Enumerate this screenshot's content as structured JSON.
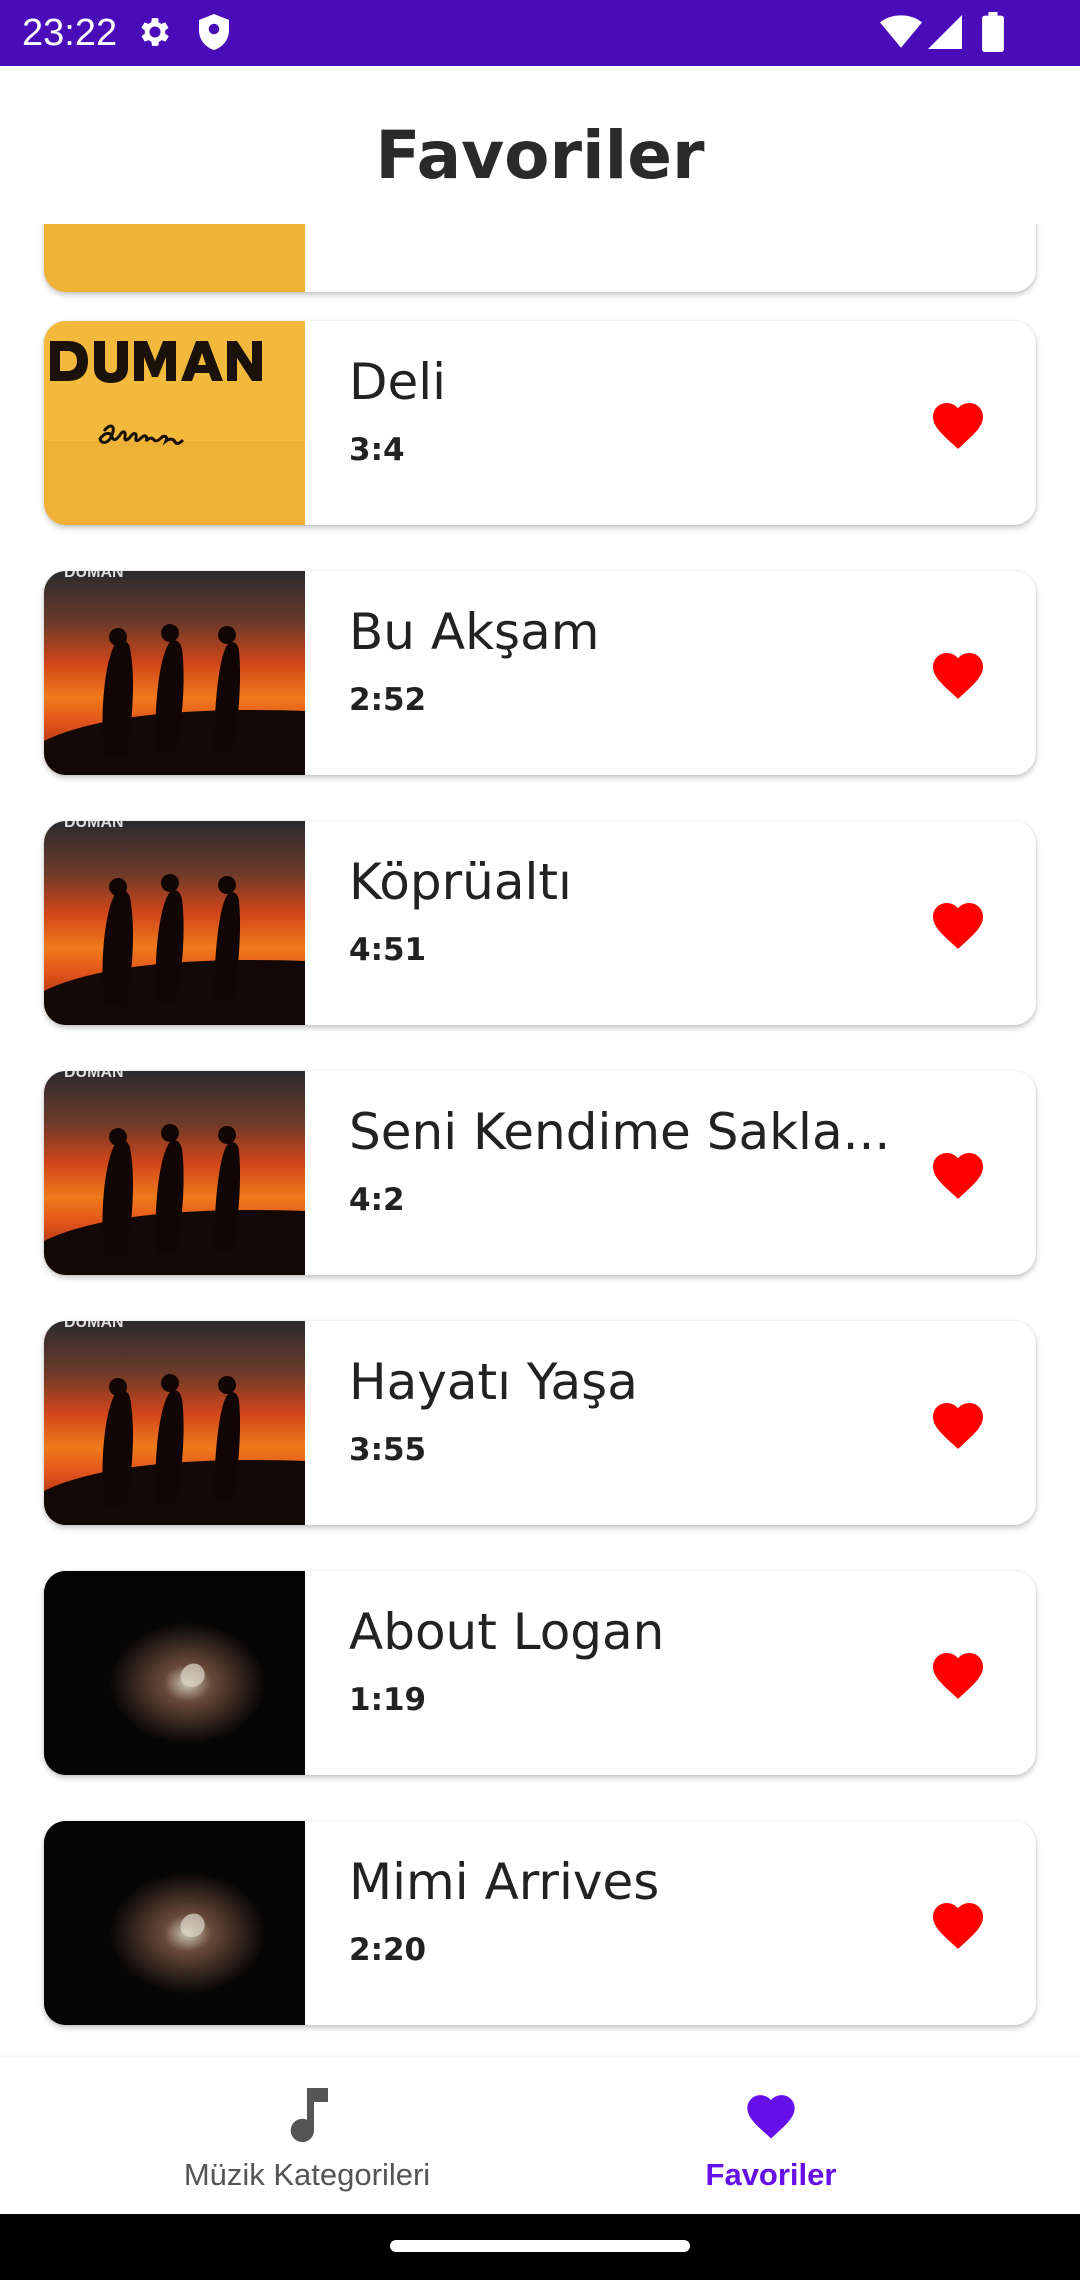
{
  "status_bar": {
    "time": "23:22",
    "background": "#4a0bb8",
    "icons": [
      "gear-icon",
      "shield-icon",
      "wifi-icon",
      "signal-icon",
      "battery-icon"
    ]
  },
  "header": {
    "title": "Favoriler"
  },
  "colors": {
    "accent": "#6510e8",
    "heart": "#ff0000"
  },
  "songs": [
    {
      "title": "",
      "duration": "",
      "cover": "duman-darmaduman-album"
    },
    {
      "title": "Deli",
      "duration": "3:4",
      "cover": "duman-darmaduman-album",
      "favorite": true
    },
    {
      "title": "Bu Akşam",
      "duration": "2:52",
      "cover": "duman-en-guzel-gunum-album",
      "favorite": true
    },
    {
      "title": "Köprüaltı",
      "duration": "4:51",
      "cover": "duman-en-guzel-gunum-album",
      "favorite": true
    },
    {
      "title": "Seni Kendime Sakla...",
      "duration": "4:2",
      "cover": "duman-en-guzel-gunum-album",
      "favorite": true
    },
    {
      "title": "Hayatı Yaşa",
      "duration": "3:55",
      "cover": "duman-en-guzel-gunum-album",
      "favorite": true
    },
    {
      "title": "About Logan",
      "duration": "1:19",
      "cover": "dark-album",
      "favorite": true
    },
    {
      "title": "Mimi Arrives",
      "duration": "2:20",
      "cover": "dark-album",
      "favorite": true
    }
  ],
  "bottom_nav": {
    "items": [
      {
        "label": "Müzik Kategorileri",
        "icon": "music-note-icon",
        "active": false
      },
      {
        "label": "Favoriler",
        "icon": "heart-icon",
        "active": true
      }
    ]
  }
}
